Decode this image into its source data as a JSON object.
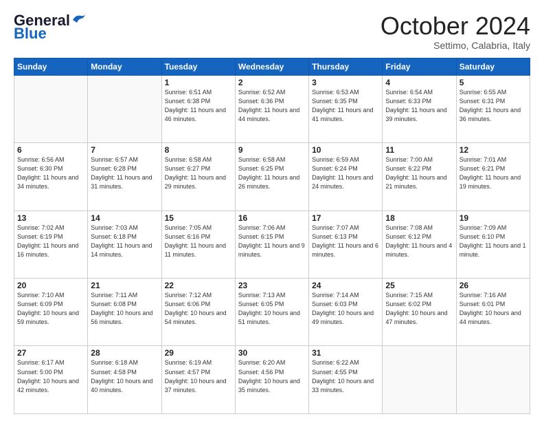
{
  "header": {
    "logo_line1": "General",
    "logo_line2": "Blue",
    "month": "October 2024",
    "location": "Settimo, Calabria, Italy"
  },
  "days_of_week": [
    "Sunday",
    "Monday",
    "Tuesday",
    "Wednesday",
    "Thursday",
    "Friday",
    "Saturday"
  ],
  "weeks": [
    [
      {
        "day": "",
        "info": ""
      },
      {
        "day": "",
        "info": ""
      },
      {
        "day": "1",
        "info": "Sunrise: 6:51 AM\nSunset: 6:38 PM\nDaylight: 11 hours and 46 minutes."
      },
      {
        "day": "2",
        "info": "Sunrise: 6:52 AM\nSunset: 6:36 PM\nDaylight: 11 hours and 44 minutes."
      },
      {
        "day": "3",
        "info": "Sunrise: 6:53 AM\nSunset: 6:35 PM\nDaylight: 11 hours and 41 minutes."
      },
      {
        "day": "4",
        "info": "Sunrise: 6:54 AM\nSunset: 6:33 PM\nDaylight: 11 hours and 39 minutes."
      },
      {
        "day": "5",
        "info": "Sunrise: 6:55 AM\nSunset: 6:31 PM\nDaylight: 11 hours and 36 minutes."
      }
    ],
    [
      {
        "day": "6",
        "info": "Sunrise: 6:56 AM\nSunset: 6:30 PM\nDaylight: 11 hours and 34 minutes."
      },
      {
        "day": "7",
        "info": "Sunrise: 6:57 AM\nSunset: 6:28 PM\nDaylight: 11 hours and 31 minutes."
      },
      {
        "day": "8",
        "info": "Sunrise: 6:58 AM\nSunset: 6:27 PM\nDaylight: 11 hours and 29 minutes."
      },
      {
        "day": "9",
        "info": "Sunrise: 6:58 AM\nSunset: 6:25 PM\nDaylight: 11 hours and 26 minutes."
      },
      {
        "day": "10",
        "info": "Sunrise: 6:59 AM\nSunset: 6:24 PM\nDaylight: 11 hours and 24 minutes."
      },
      {
        "day": "11",
        "info": "Sunrise: 7:00 AM\nSunset: 6:22 PM\nDaylight: 11 hours and 21 minutes."
      },
      {
        "day": "12",
        "info": "Sunrise: 7:01 AM\nSunset: 6:21 PM\nDaylight: 11 hours and 19 minutes."
      }
    ],
    [
      {
        "day": "13",
        "info": "Sunrise: 7:02 AM\nSunset: 6:19 PM\nDaylight: 11 hours and 16 minutes."
      },
      {
        "day": "14",
        "info": "Sunrise: 7:03 AM\nSunset: 6:18 PM\nDaylight: 11 hours and 14 minutes."
      },
      {
        "day": "15",
        "info": "Sunrise: 7:05 AM\nSunset: 6:16 PM\nDaylight: 11 hours and 11 minutes."
      },
      {
        "day": "16",
        "info": "Sunrise: 7:06 AM\nSunset: 6:15 PM\nDaylight: 11 hours and 9 minutes."
      },
      {
        "day": "17",
        "info": "Sunrise: 7:07 AM\nSunset: 6:13 PM\nDaylight: 11 hours and 6 minutes."
      },
      {
        "day": "18",
        "info": "Sunrise: 7:08 AM\nSunset: 6:12 PM\nDaylight: 11 hours and 4 minutes."
      },
      {
        "day": "19",
        "info": "Sunrise: 7:09 AM\nSunset: 6:10 PM\nDaylight: 11 hours and 1 minute."
      }
    ],
    [
      {
        "day": "20",
        "info": "Sunrise: 7:10 AM\nSunset: 6:09 PM\nDaylight: 10 hours and 59 minutes."
      },
      {
        "day": "21",
        "info": "Sunrise: 7:11 AM\nSunset: 6:08 PM\nDaylight: 10 hours and 56 minutes."
      },
      {
        "day": "22",
        "info": "Sunrise: 7:12 AM\nSunset: 6:06 PM\nDaylight: 10 hours and 54 minutes."
      },
      {
        "day": "23",
        "info": "Sunrise: 7:13 AM\nSunset: 6:05 PM\nDaylight: 10 hours and 51 minutes."
      },
      {
        "day": "24",
        "info": "Sunrise: 7:14 AM\nSunset: 6:03 PM\nDaylight: 10 hours and 49 minutes."
      },
      {
        "day": "25",
        "info": "Sunrise: 7:15 AM\nSunset: 6:02 PM\nDaylight: 10 hours and 47 minutes."
      },
      {
        "day": "26",
        "info": "Sunrise: 7:16 AM\nSunset: 6:01 PM\nDaylight: 10 hours and 44 minutes."
      }
    ],
    [
      {
        "day": "27",
        "info": "Sunrise: 6:17 AM\nSunset: 5:00 PM\nDaylight: 10 hours and 42 minutes."
      },
      {
        "day": "28",
        "info": "Sunrise: 6:18 AM\nSunset: 4:58 PM\nDaylight: 10 hours and 40 minutes."
      },
      {
        "day": "29",
        "info": "Sunrise: 6:19 AM\nSunset: 4:57 PM\nDaylight: 10 hours and 37 minutes."
      },
      {
        "day": "30",
        "info": "Sunrise: 6:20 AM\nSunset: 4:56 PM\nDaylight: 10 hours and 35 minutes."
      },
      {
        "day": "31",
        "info": "Sunrise: 6:22 AM\nSunset: 4:55 PM\nDaylight: 10 hours and 33 minutes."
      },
      {
        "day": "",
        "info": ""
      },
      {
        "day": "",
        "info": ""
      }
    ]
  ]
}
